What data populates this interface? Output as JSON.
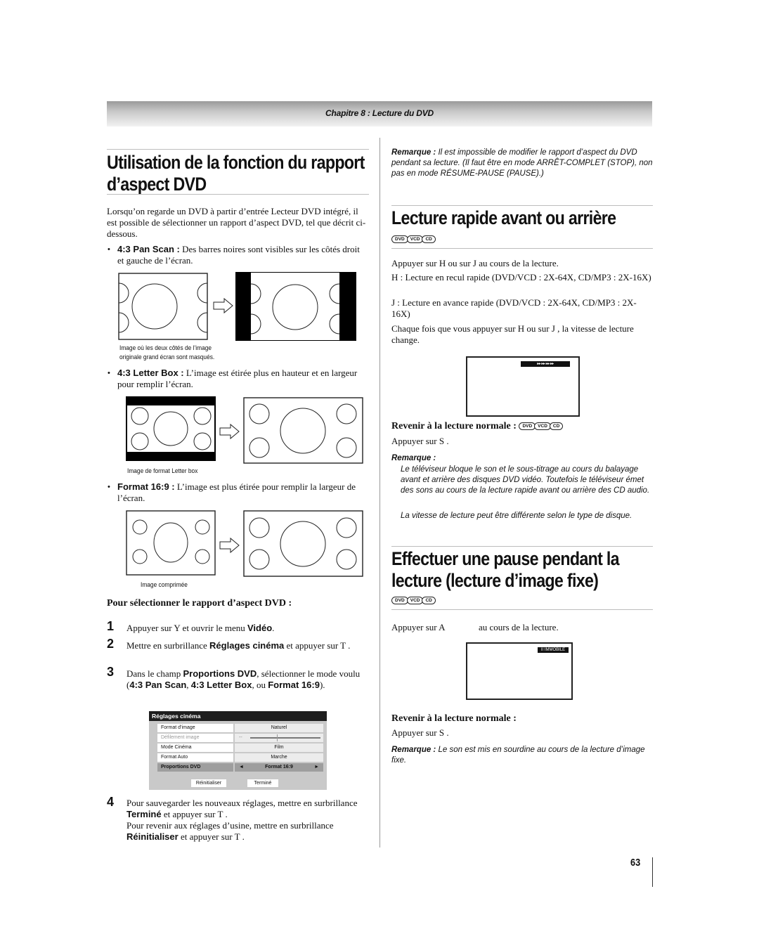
{
  "header": {
    "chapter": "Chapitre 8 : Lecture du DVD"
  },
  "left": {
    "title_line1": "Utilisation de la fonction du rapport",
    "title_line2": "d’aspect DVD",
    "intro": "Lorsqu’on regarde un DVD à partir d’entrée Lecteur DVD intégré, il est possible de sélectionner un rapport d’aspect DVD, tel que décrit ci-dessous.",
    "modes": [
      {
        "label": "4:3 Pan Scan :",
        "text": "Des barres noires sont visibles sur les côtés droit et gauche de l’écran.",
        "caption_line1": "Image où les deux côtés de l’image",
        "caption_line2": "originale grand écran sont masqués."
      },
      {
        "label": "4:3 Letter Box :",
        "text": "L’image est étirée plus en hauteur et en largeur pour remplir l’écran.",
        "caption_line1": "Image de format Letter box",
        "caption_line2": ""
      },
      {
        "label": "Format 16:9 :",
        "text": "L’image est plus étirée pour remplir la largeur de l’écran.",
        "caption_line1": "Image comprimée",
        "caption_line2": ""
      }
    ],
    "procedure_title": "Pour sélectionner le rapport d’aspect DVD :",
    "steps": [
      {
        "num": "1",
        "a": "Appuyer sur Y    et ouvrir le menu ",
        "b": "Vidéo",
        "c": "."
      },
      {
        "num": "2",
        "a": "Mettre en surbrillance ",
        "b": "Réglages cinéma",
        "c": " et appuyer sur T  ."
      },
      {
        "num": "3",
        "a": "Dans le champ ",
        "b": "Proportions DVD",
        "c": ", sélectionner le mode voulu (",
        "d": "4:3 Pan Scan",
        "e": ", ",
        "f": "4:3 Letter Box",
        "g": ", ou ",
        "h": "Format 16:9",
        "i": ")."
      },
      {
        "num": "4",
        "a": "Pour sauvegarder les nouveaux réglages, mettre en surbrillance ",
        "b": "Terminé",
        "c": " et appuyer sur T  .",
        "d": "Pour revenir aux réglages d’usine, mettre en surbrillance ",
        "e": "Réinitialiser",
        "f": " et appuyer sur T  ."
      }
    ],
    "menu": {
      "title": "Réglages cinéma",
      "rows": [
        {
          "label": "Format d’image",
          "value": "Naturel"
        },
        {
          "label": "Défilement image",
          "value": "--"
        },
        {
          "label": "Mode Cinéma",
          "value": "Film"
        },
        {
          "label": "Format Auto",
          "value": "Marche"
        },
        {
          "label": "Proportions DVD",
          "value": "Format 16:9"
        }
      ],
      "reset": "Réinitialiser",
      "done": "Terminé",
      "arrow_left": "◄",
      "arrow_right": "►"
    }
  },
  "right": {
    "note1_label": "Remarque :",
    "note1_text": " Il est impossible de modifier le rapport d’aspect du DVD pendant sa lecture. (Il faut être en mode ARRÊT-COMPLET (STOP), non pas en mode RÉSUME-PAUSE (PAUSE).)",
    "section1_title": "Lecture rapide avant ou arrière",
    "discs": [
      "DVD",
      "VCD",
      "CD"
    ],
    "s1_p1": "Appuyer sur H   ou sur J    au cours de la lecture.",
    "s1_p2": "H   : Lecture en recul rapide (DVD/VCD : 2X-64X, CD/MP3 : 2X-16X)",
    "s1_p3": "J   : Lecture en avance rapide (DVD/VCD : 2X-64X, CD/MP3 : 2X-16X)",
    "s1_p4": "Chaque fois que vous appuyer sur H   ou sur J   , la vitesse de lecture change.",
    "osd_ff": "▸▸ ▸▸ ▸▸ ▸▸",
    "s1_sub": "Revenir à la lecture normale :",
    "s1_sub_text": "Appuyer sur S  .",
    "s1_note_label": "Remarque :",
    "s1_note_1": "Le téléviseur bloque le son et le sous-titrage au cours du balayage avant et arrière des disques DVD vidéo. Toutefois le téléviseur émet des sons au cours de la lecture rapide avant ou arrière des CD audio.",
    "s1_note_2": "La vitesse de lecture peut être différente selon le type de disque.",
    "section2_title_line1": "Effectuer une pause pendant la",
    "section2_title_line2": "lecture (lecture d’image fixe)",
    "s2_p1_a": "Appuyer sur A",
    "s2_p1_b": "au cours de la lecture.",
    "osd_still": "II  IMMOBILE",
    "s2_sub": "Revenir à la lecture normale :",
    "s2_sub_text": "Appuyer sur S  .",
    "s2_note_label": "Remarque :",
    "s2_note_text": " Le son est mis en sourdine au cours de la lecture d’image fixe."
  },
  "footer": {
    "page_number": "63"
  }
}
